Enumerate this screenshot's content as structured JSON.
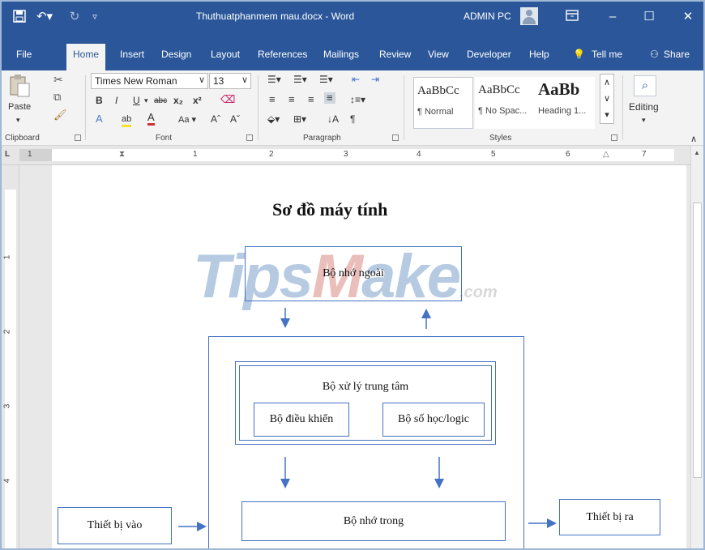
{
  "app": {
    "document_title": "Thuthuatphanmem mau.docx  -  Word",
    "user": "ADMIN PC"
  },
  "tabs": [
    "File",
    "Home",
    "Insert",
    "Design",
    "Layout",
    "References",
    "Mailings",
    "Review",
    "View",
    "Developer",
    "Help",
    "Tell me",
    "Share"
  ],
  "ribbon": {
    "clipboard": {
      "paste_label": "Paste",
      "group_label": "Clipboard"
    },
    "font": {
      "font_name": "Times New Roman",
      "font_size": "13",
      "group_label": "Font"
    },
    "paragraph": {
      "group_label": "Paragraph"
    },
    "styles": {
      "group_label": "Styles",
      "items": [
        {
          "sample": "AaBbCc",
          "name": "¶ Normal"
        },
        {
          "sample": "AaBbCc",
          "name": "¶ No Spac..."
        },
        {
          "sample": "AaBb",
          "name": "Heading 1..."
        }
      ]
    },
    "editing": {
      "label": "Editing"
    }
  },
  "ruler": {
    "numbers": [
      "1",
      "1",
      "2",
      "3",
      "4",
      "5",
      "6",
      "7"
    ],
    "vertical_numbers": [
      "1",
      "2",
      "3",
      "4"
    ]
  },
  "document": {
    "title": "Sơ đồ máy tính",
    "boxes": {
      "external_memory": "Bộ nhớ ngoài",
      "cpu": "Bộ xử lý trung tâm",
      "control_unit": "Bộ điều khiển",
      "alu": "Bộ số học/logic",
      "internal_memory": "Bộ nhớ trong",
      "input_device": "Thiết bị vào",
      "output_device": "Thiết bị ra"
    },
    "watermark": {
      "part1": "Tips",
      "part2": "M",
      "part3": "ake",
      "part4": ".com"
    }
  },
  "colors": {
    "word_blue": "#2b579a",
    "diagram_line": "#4472c4"
  }
}
